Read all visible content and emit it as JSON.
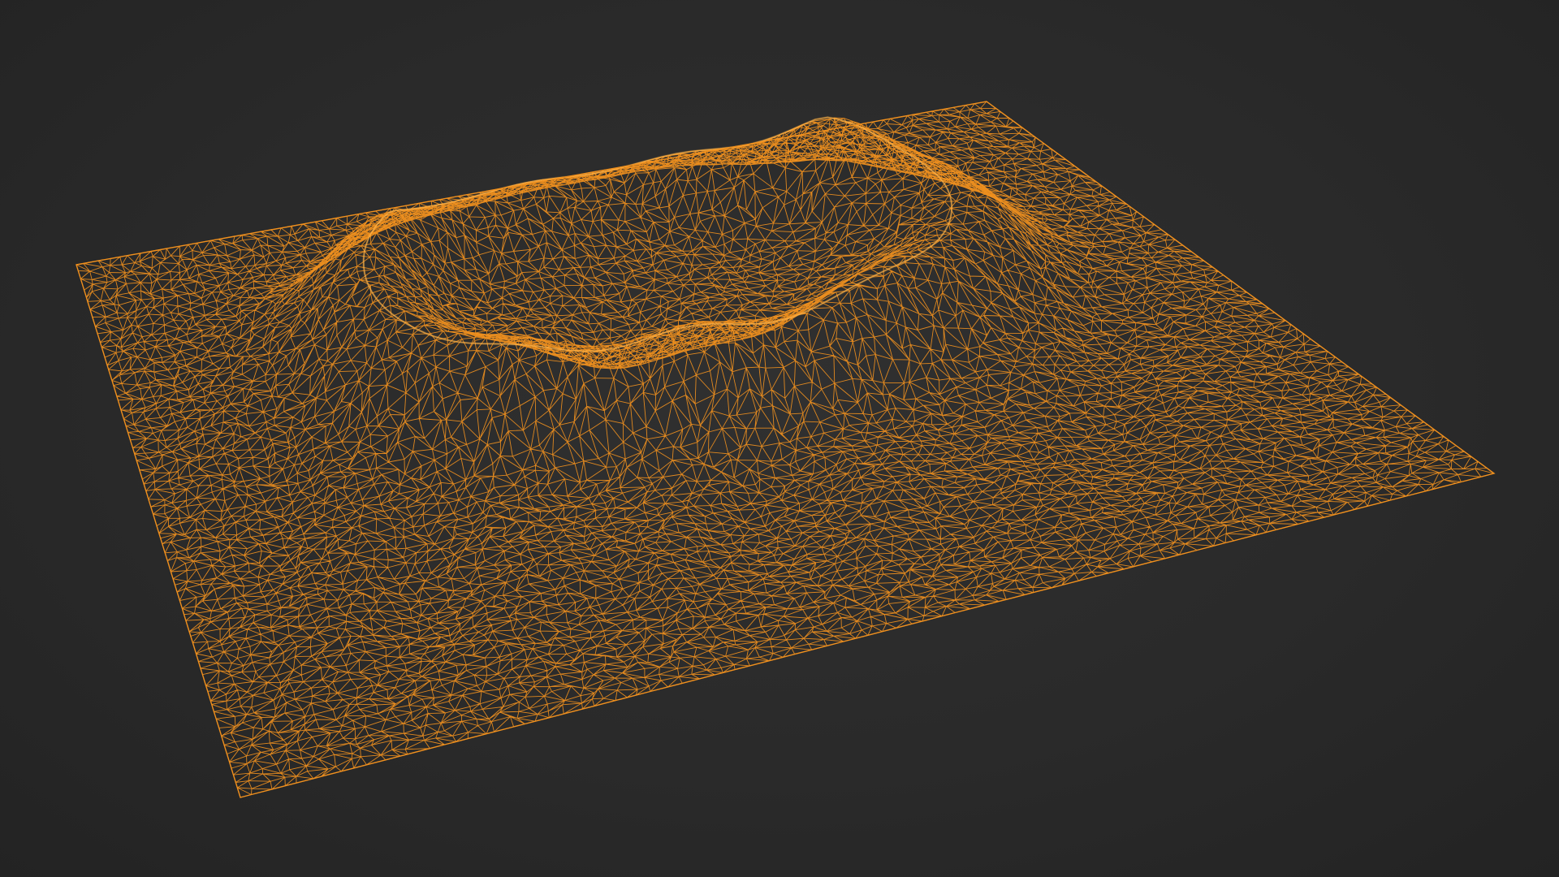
{
  "scene": {
    "subject": "terrain-wireframe-mesh",
    "colors": {
      "background": "#2a2a2a",
      "wire": "#f0901e",
      "wire_highlight": "#ffb347"
    }
  }
}
